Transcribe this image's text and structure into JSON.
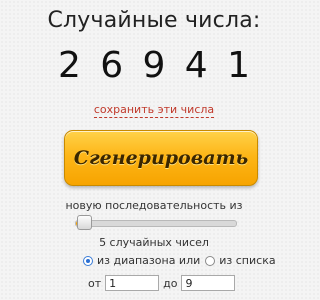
{
  "header": {
    "title": "Случайные числа:"
  },
  "result": {
    "numbers": [
      "2",
      "6",
      "9",
      "4",
      "1"
    ]
  },
  "actions": {
    "save_link": "сохранить эти числа",
    "generate_button": "Сгенерировать"
  },
  "settings": {
    "sequence_label": "новую последовательность из",
    "count_text": "5 случайных чисел",
    "slider": {
      "fraction": 0.05
    },
    "source": {
      "from_range_label": "из диапазона или",
      "from_list_label": "из списка",
      "selected": "range"
    },
    "range": {
      "from_label": "от",
      "from_value": "1",
      "to_label": "до",
      "to_value": "9"
    }
  },
  "colors": {
    "accent": "#f7a400",
    "link": "#c0392b",
    "radio_selected": "#2b6fd3"
  }
}
